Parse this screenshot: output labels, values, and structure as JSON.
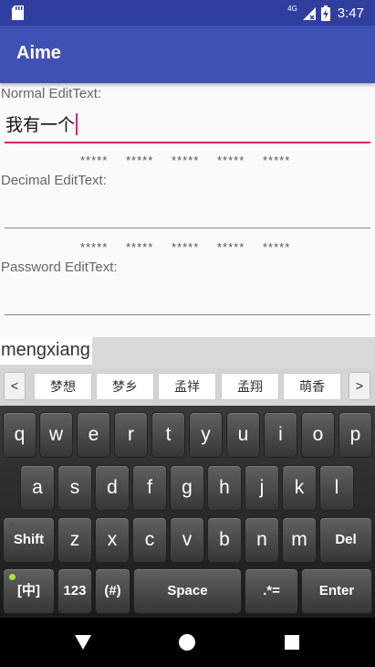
{
  "status_bar": {
    "network_label": "4G",
    "time": "3:47",
    "icons": [
      "sd-card-icon",
      "signal-icon",
      "battery-charging-icon"
    ]
  },
  "app_bar": {
    "title": "Aime"
  },
  "form": {
    "normal_label": "Normal EditText:",
    "normal_value": "我有一个",
    "decimal_label": "Decimal EditText:",
    "decimal_value": "",
    "password_label": "Password EditText:",
    "password_value": "",
    "stars_row_1": [
      "*****",
      "*****",
      "*****",
      "*****",
      "*****"
    ],
    "stars_row_2": [
      "*****",
      "*****",
      "*****",
      "*****",
      "*****"
    ]
  },
  "ime": {
    "composing": "mengxiang",
    "prev_label": "<",
    "next_label": ">",
    "candidates": [
      "梦想",
      "梦乡",
      "孟祥",
      "孟翔",
      "萌香"
    ],
    "rows": [
      [
        "q",
        "w",
        "e",
        "r",
        "t",
        "y",
        "u",
        "i",
        "o",
        "p"
      ],
      [
        "a",
        "s",
        "d",
        "f",
        "g",
        "h",
        "j",
        "k",
        "l"
      ],
      [
        "Shift",
        "z",
        "x",
        "c",
        "v",
        "b",
        "n",
        "m",
        "Del"
      ],
      [
        "[中]",
        "123",
        "(#)",
        "Space",
        ".*=",
        "Enter"
      ]
    ]
  },
  "colors": {
    "status_bar": "#303f9f",
    "app_bar": "#3f51b5",
    "accent": "#e91e63"
  }
}
